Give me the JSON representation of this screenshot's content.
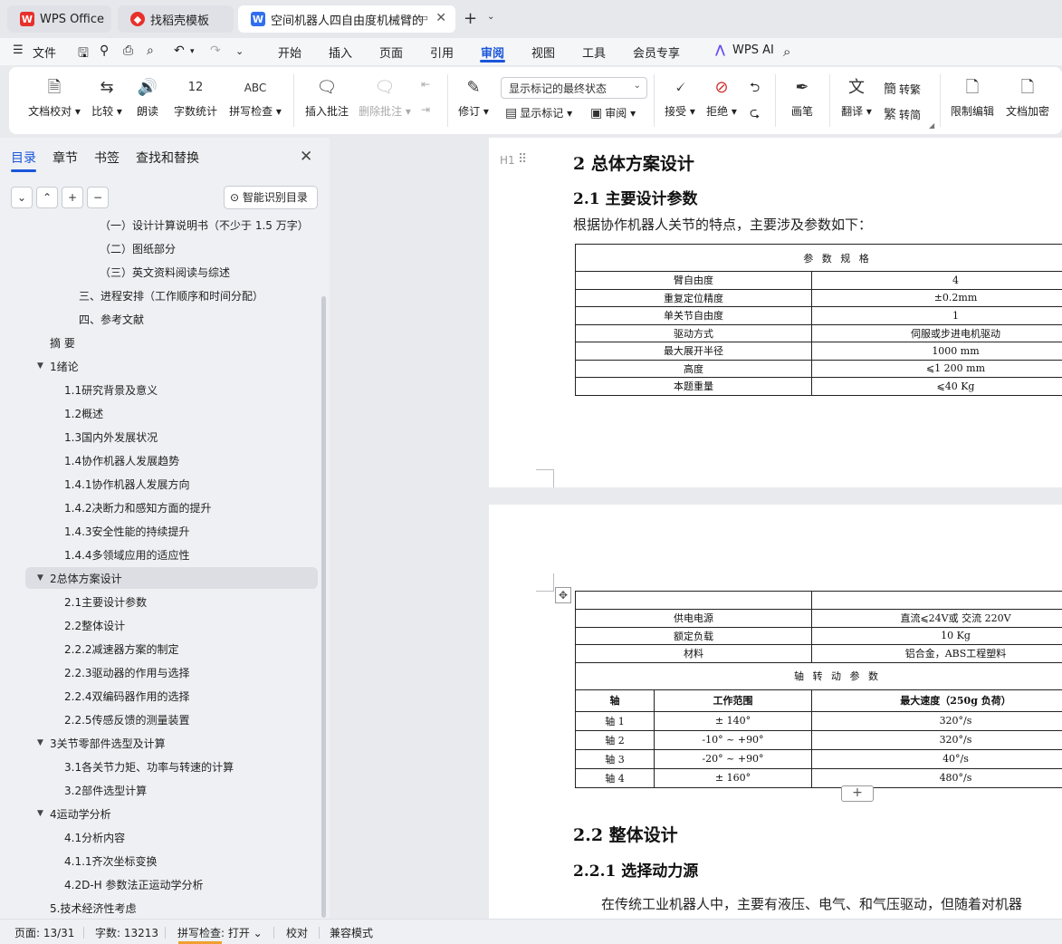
{
  "tabs": [
    {
      "label": "WPS Office",
      "icon": "wps-logo-icon"
    },
    {
      "label": "找稻壳模板",
      "icon": "docer-icon"
    },
    {
      "label": "空间机器人四自由度机械臂的",
      "icon": "word-doc-icon",
      "icon_text": "W"
    }
  ],
  "menu": {
    "file": "文件",
    "items": [
      "开始",
      "插入",
      "页面",
      "引用",
      "审阅",
      "视图",
      "工具",
      "会员专享"
    ],
    "active": "审阅",
    "wps_ai": "WPS AI"
  },
  "ribbon": {
    "doc_check": "文档校对",
    "compare": "比较",
    "read_aloud": "朗读",
    "word_count": "字数统计",
    "spell_check": "拼写检查",
    "insert_comment": "插入批注",
    "delete_comment": "删除批注",
    "track_changes": "修订",
    "display_state": "显示标记的最终状态",
    "show_markup": "显示标记",
    "review": "审阅",
    "accept": "接受",
    "reject": "拒绝",
    "pen": "画笔",
    "translate": "翻译",
    "to_traditional": "转繁",
    "to_simplified": "转简",
    "restrict_edit": "限制编辑",
    "doc_encrypt": "文档加密",
    "abc": "ABC",
    "count_icon_text": "12"
  },
  "sidebar": {
    "tabs": [
      "目录",
      "章节",
      "书签",
      "查找和替换"
    ],
    "smart_toc": "智能识别目录",
    "toc": [
      {
        "label": "（一）设计计算说明书（不少于 1.5 万字）",
        "level": 3
      },
      {
        "label": "（二）图纸部分",
        "level": 3
      },
      {
        "label": "（三）英文资料阅读与综述",
        "level": 3
      },
      {
        "label": "三、进程安排（工作顺序和时间分配）",
        "level": 2
      },
      {
        "label": "四、参考文献",
        "level": 2
      },
      {
        "label": "摘 要",
        "level": 0
      },
      {
        "label": "1绪论",
        "level": 0,
        "expanded": true
      },
      {
        "label": "1.1研究背景及意义",
        "level": 1
      },
      {
        "label": "1.2概述",
        "level": 1
      },
      {
        "label": "1.3国内外发展状况",
        "level": 1
      },
      {
        "label": "1.4协作机器人发展趋势",
        "level": 1
      },
      {
        "label": "1.4.1协作机器人发展方向",
        "level": 1
      },
      {
        "label": "1.4.2决断力和感知方面的提升",
        "level": 1
      },
      {
        "label": "1.4.3安全性能的持续提升",
        "level": 1
      },
      {
        "label": "1.4.4多领域应用的适应性",
        "level": 1
      },
      {
        "label": "2总体方案设计",
        "level": 0,
        "expanded": true,
        "selected": true
      },
      {
        "label": "2.1主要设计参数",
        "level": 1
      },
      {
        "label": "2.2整体设计",
        "level": 1
      },
      {
        "label": "2.2.2减速器方案的制定",
        "level": 1
      },
      {
        "label": "2.2.3驱动器的作用与选择",
        "level": 1
      },
      {
        "label": "2.2.4双编码器作用的选择",
        "level": 1
      },
      {
        "label": "2.2.5传感反馈的测量装置",
        "level": 1
      },
      {
        "label": "3关节零部件选型及计算",
        "level": 0,
        "expanded": true
      },
      {
        "label": "3.1各关节力矩、功率与转速的计算",
        "level": 1
      },
      {
        "label": "3.2部件选型计算",
        "level": 1
      },
      {
        "label": "4运动学分析",
        "level": 0,
        "expanded": true
      },
      {
        "label": "4.1分析内容",
        "level": 1
      },
      {
        "label": "4.1.1齐次坐标变换",
        "level": 1
      },
      {
        "label": "4.2D-H 参数法正运动学分析",
        "level": 1
      },
      {
        "label": "5.技术经济性考虑",
        "level": 0
      }
    ]
  },
  "document": {
    "heading_mark": "H1",
    "h2_total": "2 总体方案设计",
    "h3_main_params": "2.1 主要设计参数",
    "intro": "根据协作机器人关节的特点，主要涉及参数如下：",
    "spec_title": "参 数 规 格",
    "spec_rows": [
      {
        "name": "臂自由度",
        "value": "4"
      },
      {
        "name": "重复定位精度",
        "value": "±0.2mm"
      },
      {
        "name": "单关节自由度",
        "value": "1"
      },
      {
        "name": "驱动方式",
        "value": "伺服或步进电机驱动"
      },
      {
        "name": "最大展开半径",
        "value": "1000 mm"
      },
      {
        "name": "高度",
        "value": "⩽1 200 mm"
      },
      {
        "name": "本题重量",
        "value": "⩽40 Kg"
      }
    ],
    "spec_rows_2": [
      {
        "name": "供电电源",
        "value": "直流⩽24V或 交流 220V"
      },
      {
        "name": "额定负载",
        "value": "10 Kg"
      },
      {
        "name": "材料",
        "value": "铝合金，ABS工程塑料"
      }
    ],
    "axis_title": "轴 转 动 参 数",
    "axis_headers": [
      "轴",
      "工作范围",
      "最大速度（250g 负荷）"
    ],
    "axis_rows": [
      {
        "axis": "轴 1",
        "range": "± 140°",
        "speed": "320°/s"
      },
      {
        "axis": "轴 2",
        "range": "-10° ~ +90°",
        "speed": "320°/s"
      },
      {
        "axis": "轴 3",
        "range": "-20° ~ +90°",
        "speed": "40°/s"
      },
      {
        "axis": "轴 4",
        "range": "± 160°",
        "speed": "480°/s"
      }
    ],
    "h2_overall": "2.2 整体设计",
    "h3_power": "2.2.1 选择动力源",
    "para_power": "在传统工业机器人中，主要有液压、电气、和气压驱动，但随着对机器"
  },
  "status": {
    "page": "页面: 13/31",
    "words": "字数: 13213",
    "spell": "拼写检查: 打开",
    "proof": "校对",
    "compat": "兼容模式"
  }
}
